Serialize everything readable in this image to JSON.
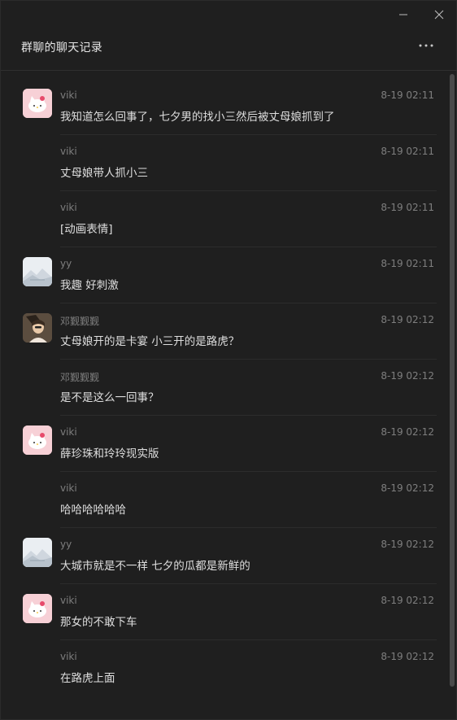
{
  "window": {
    "title": "群聊的聊天记录",
    "controls": {
      "minimize_icon": "minimize-icon",
      "close_icon": "close-icon",
      "more_icon": "more-icon"
    }
  },
  "colors": {
    "background": "#1f1f1f",
    "text": "#dedede",
    "meta": "#7e7e7e",
    "divider": "#2c2c2c"
  },
  "messages": [
    {
      "sender": "viki",
      "time": "8-19 02:11",
      "text": "我知道怎么回事了，七夕男的找小三然后被丈母娘抓到了",
      "avatar": "kitty"
    },
    {
      "sender": "viki",
      "time": "8-19 02:11",
      "text": "丈母娘带人抓小三",
      "avatar": ""
    },
    {
      "sender": "viki",
      "time": "8-19 02:11",
      "text": "[动画表情]",
      "avatar": ""
    },
    {
      "sender": "yy",
      "time": "8-19 02:11",
      "text": "我趣 好刺激",
      "avatar": "yy"
    },
    {
      "sender": "邓觐觐觐",
      "time": "8-19 02:12",
      "text": "丈母娘开的是卡宴 小三开的是路虎？",
      "avatar": "deng"
    },
    {
      "sender": "邓觐觐觐",
      "time": "8-19 02:12",
      "text": "是不是这么一回事？",
      "avatar": ""
    },
    {
      "sender": "viki",
      "time": "8-19 02:12",
      "text": "薛珍珠和玲玲现实版",
      "avatar": "kitty"
    },
    {
      "sender": "viki",
      "time": "8-19 02:12",
      "text": "哈哈哈哈哈哈",
      "avatar": ""
    },
    {
      "sender": "yy",
      "time": "8-19 02:12",
      "text": "大城市就是不一样 七夕的瓜都是新鲜的",
      "avatar": "yy"
    },
    {
      "sender": "viki",
      "time": "8-19 02:12",
      "text": "那女的不敢下车",
      "avatar": "kitty"
    },
    {
      "sender": "viki",
      "time": "8-19 02:12",
      "text": "在路虎上面",
      "avatar": ""
    }
  ]
}
